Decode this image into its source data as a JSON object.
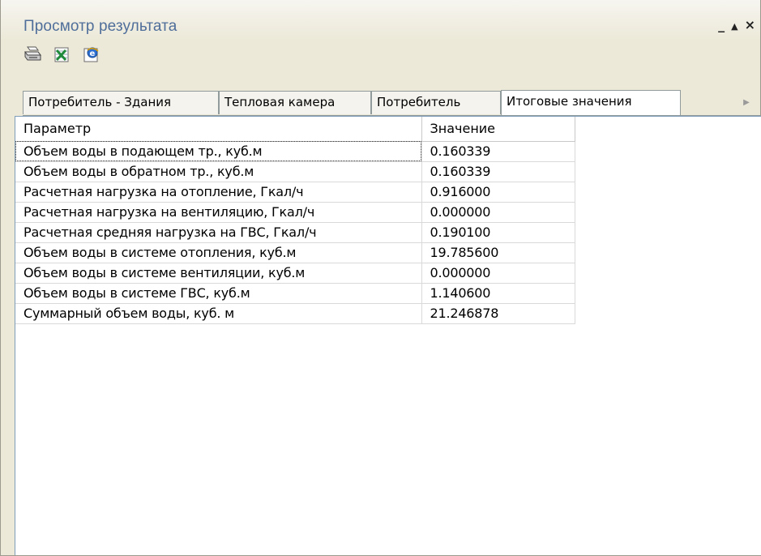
{
  "window": {
    "title": "Просмотр результата",
    "controls": {
      "minimize": "_",
      "pin": "▲",
      "close": "×"
    }
  },
  "toolbar": {
    "buttons": [
      {
        "icon": "print-icon",
        "label": ""
      },
      {
        "icon": "excel-export-icon",
        "label": ""
      },
      {
        "icon": "browser-export-icon",
        "label": ""
      }
    ]
  },
  "tabs": [
    {
      "label": "Потребитель - Здания",
      "active": false
    },
    {
      "label": "Тепловая камера",
      "active": false
    },
    {
      "label": "Потребитель",
      "active": false
    },
    {
      "label": "Итоговые значения",
      "active": true
    }
  ],
  "grid": {
    "columns": [
      "Параметр",
      "Значение"
    ],
    "rows": [
      {
        "param": "Объем воды в подающем тр., куб.м",
        "value": "0.160339"
      },
      {
        "param": "Объем воды в обратном тр., куб.м",
        "value": "0.160339"
      },
      {
        "param": "Расчетная нагрузка на отопление, Гкал/ч",
        "value": "0.916000"
      },
      {
        "param": "Расчетная нагрузка на вентиляцию, Гкал/ч",
        "value": "0.000000"
      },
      {
        "param": "Расчетная средняя нагрузка на ГВС, Гкал/ч",
        "value": "0.190100"
      },
      {
        "param": "Объем воды в системе отопления, куб.м",
        "value": "19.785600"
      },
      {
        "param": "Объем воды в системе вентиляции, куб.м",
        "value": "0.000000"
      },
      {
        "param": "Объем воды в системе ГВС, куб.м",
        "value": "1.140600"
      },
      {
        "param": "Суммарный объем воды, куб. м",
        "value": "21.246878"
      }
    ]
  },
  "colors": {
    "title": "#4f6e9a",
    "background": "#ece9d8",
    "grid_background": "#ffffff"
  }
}
